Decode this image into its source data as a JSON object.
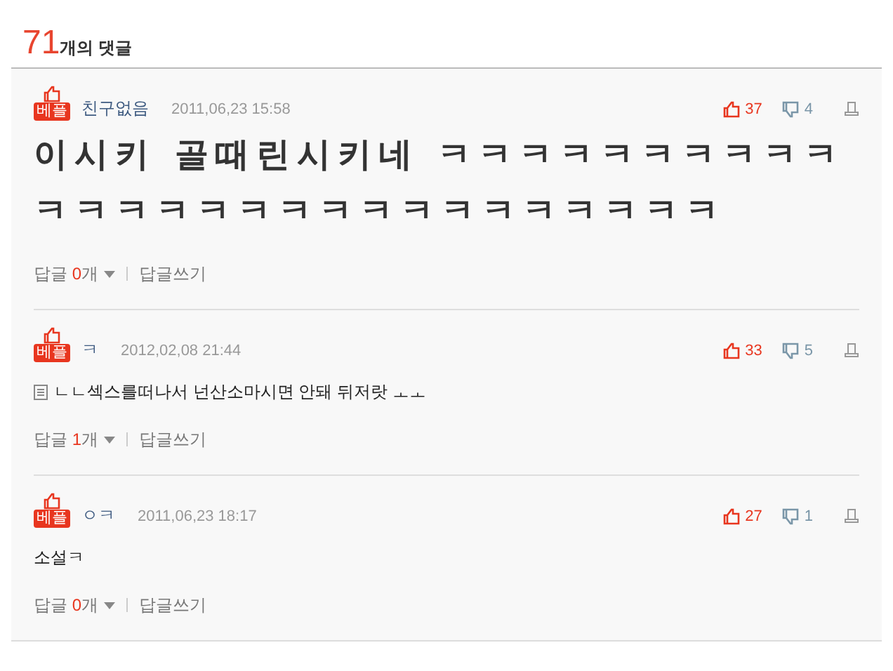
{
  "header": {
    "count": "71",
    "label": "개의 댓글"
  },
  "comments": [
    {
      "badge": "베플",
      "author": "친구없음",
      "date": "2011,06,23 15:58",
      "likes": "37",
      "dislikes": "4",
      "kind": "large",
      "text": "이시키 골때린시키네 ㅋㅋㅋㅋㅋㅋㅋㅋㅋㅋㅋㅋㅋㅋㅋㅋㅋㅋㅋㅋㅋㅋㅋㅋㅋㅋㅋ",
      "reply_label": "답글",
      "reply_count": "0",
      "reply_unit": "개",
      "write": "답글쓰기"
    },
    {
      "badge": "베플",
      "author": "ㅋ",
      "date": "2012,02,08 21:44",
      "likes": "33",
      "dislikes": "5",
      "kind": "mobile",
      "text": "ㄴㄴ섹스를떠나서 넌산소마시면 안돼 뒤저랏 ㅗㅗ",
      "reply_label": "답글",
      "reply_count": "1",
      "reply_unit": "개",
      "write": "답글쓰기"
    },
    {
      "badge": "베플",
      "author": "ㅇㅋ",
      "date": "2011,06,23 18:17",
      "likes": "27",
      "dislikes": "1",
      "kind": "plain",
      "text": "소설ㅋ",
      "reply_label": "답글",
      "reply_count": "0",
      "reply_unit": "개",
      "write": "답글쓰기"
    }
  ]
}
